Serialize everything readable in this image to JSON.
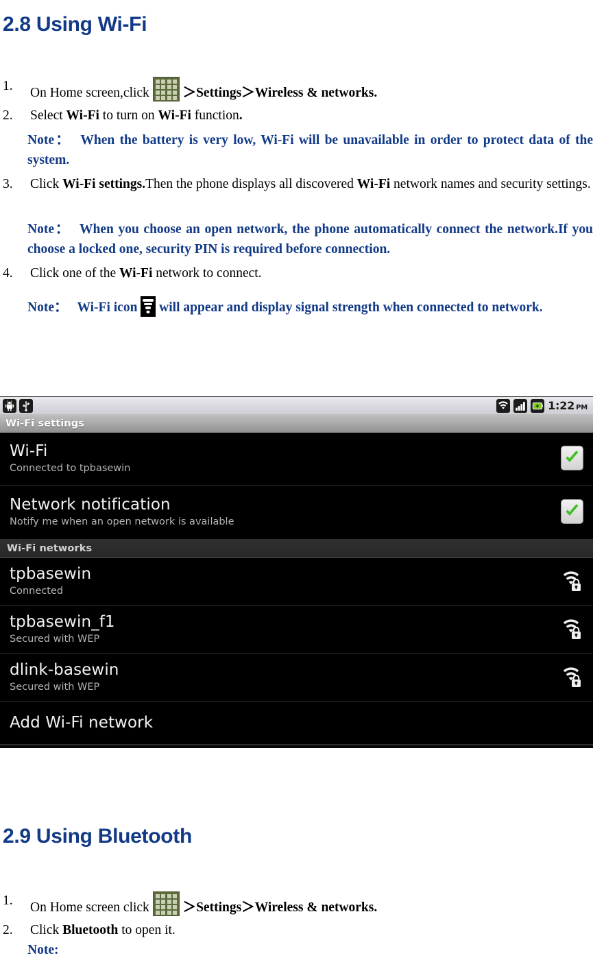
{
  "document": {
    "sections": [
      {
        "id": "wifi",
        "heading": "2.8 Using Wi-Fi"
      },
      {
        "id": "bluetooth",
        "heading": "2.9 Using Bluetooth"
      }
    ],
    "wifi_steps": {
      "s1_num": "1.",
      "s1_pre": "On Home screen,click",
      "s1_arrow1": "＞",
      "s1_settings": "Settings",
      "s1_arrow2": "＞",
      "s1_wireless": "Wireless & networks.",
      "s2_num": "2.",
      "s2_a": "Select ",
      "s2_b1": "Wi-Fi",
      "s2_c": " to turn on ",
      "s2_b2": "Wi-Fi",
      "s2_d": " function",
      "s2_dot": ".",
      "note1_label": "Note：",
      "note1_text": "When the battery is very low, Wi-Fi will be unavailable in order to protect data of the system.",
      "s3_num": "3.",
      "s3_a": "Click ",
      "s3_b1": "Wi-Fi settings.",
      "s3_c": "Then the phone displays all discovered ",
      "s3_b2": "Wi-Fi",
      "s3_d": " network names and security settings.",
      "note2_label": "Note：",
      "note2_text": "When you choose an open network, the phone automatically connect the network.If you choose a locked one, security PIN is required before connection.",
      "s4_num": "4.",
      "s4_a": "Click one of the ",
      "s4_b1": "Wi-Fi",
      "s4_c": " network to connect.",
      "note3_label": "Note：",
      "note3_a": "Wi-Fi icon",
      "note3_b": "will appear and display signal strength when connected to network."
    },
    "bluetooth_steps": {
      "s1_num": "1.",
      "s1_pre": "On Home screen click",
      "s1_arrow1": "＞",
      "s1_settings": "Settings",
      "s1_arrow2": "＞",
      "s1_wireless": "Wireless & networks.",
      "s2_num": "2.",
      "s2_a": "Click ",
      "s2_b1": "Bluetooth",
      "s2_c": " to open it.",
      "note_label": "Note:"
    }
  },
  "phone_screenshot": {
    "status_bar": {
      "left_icons": [
        "android-robot-icon",
        "usb-icon"
      ],
      "right_icons": [
        "wifi-signal-icon",
        "cell-signal-icon",
        "battery-charging-icon"
      ],
      "time": "1:22",
      "ampm": "PM"
    },
    "title_bar": {
      "title": "Wi-Fi settings"
    },
    "rows": [
      {
        "name": "wifi-toggle-row",
        "title": "Wi-Fi",
        "subtitle": "Connected to tpbasewin",
        "accessory": "checkbox-checked"
      },
      {
        "name": "network-notification-row",
        "title": "Network notification",
        "subtitle": "Notify me when an open network is available",
        "accessory": "checkbox-checked"
      }
    ],
    "section_header": "Wi-Fi networks",
    "networks": [
      {
        "ssid": "tpbasewin",
        "status": "Connected",
        "accessory": "wifi-secured-icon"
      },
      {
        "ssid": "tpbasewin_f1",
        "status": "Secured with WEP",
        "accessory": "wifi-secured-icon"
      },
      {
        "ssid": "dlink-basewin",
        "status": "Secured with WEP",
        "accessory": "wifi-secured-icon"
      }
    ],
    "add_network": {
      "label": "Add Wi-Fi network"
    },
    "colors": {
      "accent_heading": "#123a87",
      "check_green": "#3fbe28",
      "row_background": "#000000",
      "row_title": "#f2f2f2",
      "row_subtitle": "#b4b4b4"
    }
  }
}
